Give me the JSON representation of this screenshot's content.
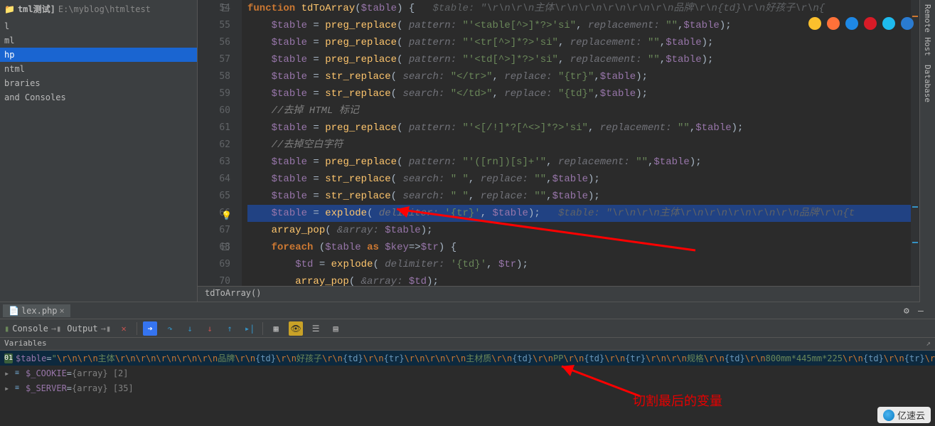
{
  "sidebar": {
    "project_label": "tml测试]",
    "project_path": "E:\\myblog\\htmltest",
    "items": [
      {
        "label": "l"
      },
      {
        "label": "ml"
      },
      {
        "label": "hp"
      },
      {
        "label": "ntml"
      },
      {
        "label": "braries"
      },
      {
        "label": "and Consoles"
      }
    ],
    "selected_index": 2
  },
  "right_tabs": [
    "Remote Host",
    "Database"
  ],
  "browsers": [
    {
      "name": "chrome",
      "color": "#fbc02d"
    },
    {
      "name": "firefox",
      "color": "#ff7139"
    },
    {
      "name": "safari",
      "color": "#1e88e5"
    },
    {
      "name": "opera",
      "color": "#d81b27"
    },
    {
      "name": "ie",
      "color": "#1ebbee"
    },
    {
      "name": "edge",
      "color": "#2a7bd1"
    }
  ],
  "editor": {
    "breadcrumb": "tdToArray()",
    "highlight_line": 66,
    "breakpoint_line": 55,
    "bulb_line": 66,
    "lines": [
      {
        "n": 54,
        "raw": "function tdToArray($table) {   $table: \"\\r\\n\\r\\n主体\\r\\n\\r\\n\\r\\n\\r\\n\\r\\n品牌\\r\\n{td}\\r\\n好孩子\\r\\n{",
        "segments": [
          {
            "t": "function ",
            "c": "kw"
          },
          {
            "t": "tdToArray",
            "c": "fn"
          },
          {
            "t": "(",
            "c": "op"
          },
          {
            "t": "$table",
            "c": "var"
          },
          {
            "t": ") {",
            "c": "op"
          },
          {
            "t": "   $table: \"\\r\\n\\r\\n主体\\r\\n\\r\\n\\r\\n\\r\\n\\r\\n品牌\\r\\n{td}\\r\\n好孩子\\r\\n{",
            "c": "hint"
          }
        ]
      },
      {
        "n": 55,
        "segments": [
          {
            "t": "    ",
            "c": "op"
          },
          {
            "t": "$table",
            "c": "var"
          },
          {
            "t": " = ",
            "c": "op"
          },
          {
            "t": "preg_replace",
            "c": "fn"
          },
          {
            "t": "( ",
            "c": "op"
          },
          {
            "t": "pattern:",
            "c": "pname"
          },
          {
            "t": " ",
            "c": "op"
          },
          {
            "t": "\"'<table[^>]*?>'si\"",
            "c": "str"
          },
          {
            "t": ", ",
            "c": "op"
          },
          {
            "t": "replacement:",
            "c": "pname"
          },
          {
            "t": " ",
            "c": "op"
          },
          {
            "t": "\"\"",
            "c": "str"
          },
          {
            "t": ",",
            "c": "op"
          },
          {
            "t": "$table",
            "c": "var"
          },
          {
            "t": ");",
            "c": "op"
          }
        ]
      },
      {
        "n": 56,
        "segments": [
          {
            "t": "    ",
            "c": "op"
          },
          {
            "t": "$table",
            "c": "var"
          },
          {
            "t": " = ",
            "c": "op"
          },
          {
            "t": "preg_replace",
            "c": "fn"
          },
          {
            "t": "( ",
            "c": "op"
          },
          {
            "t": "pattern:",
            "c": "pname"
          },
          {
            "t": " ",
            "c": "op"
          },
          {
            "t": "\"'<tr[^>]*?>'si\"",
            "c": "str"
          },
          {
            "t": ", ",
            "c": "op"
          },
          {
            "t": "replacement:",
            "c": "pname"
          },
          {
            "t": " ",
            "c": "op"
          },
          {
            "t": "\"\"",
            "c": "str"
          },
          {
            "t": ",",
            "c": "op"
          },
          {
            "t": "$table",
            "c": "var"
          },
          {
            "t": ");",
            "c": "op"
          }
        ]
      },
      {
        "n": 57,
        "segments": [
          {
            "t": "    ",
            "c": "op"
          },
          {
            "t": "$table",
            "c": "var"
          },
          {
            "t": " = ",
            "c": "op"
          },
          {
            "t": "preg_replace",
            "c": "fn"
          },
          {
            "t": "( ",
            "c": "op"
          },
          {
            "t": "pattern:",
            "c": "pname"
          },
          {
            "t": " ",
            "c": "op"
          },
          {
            "t": "\"'<td[^>]*?>'si\"",
            "c": "str"
          },
          {
            "t": ", ",
            "c": "op"
          },
          {
            "t": "replacement:",
            "c": "pname"
          },
          {
            "t": " ",
            "c": "op"
          },
          {
            "t": "\"\"",
            "c": "str"
          },
          {
            "t": ",",
            "c": "op"
          },
          {
            "t": "$table",
            "c": "var"
          },
          {
            "t": ");",
            "c": "op"
          }
        ]
      },
      {
        "n": 58,
        "segments": [
          {
            "t": "    ",
            "c": "op"
          },
          {
            "t": "$table",
            "c": "var"
          },
          {
            "t": " = ",
            "c": "op"
          },
          {
            "t": "str_replace",
            "c": "fn"
          },
          {
            "t": "( ",
            "c": "op"
          },
          {
            "t": "search:",
            "c": "pname"
          },
          {
            "t": " ",
            "c": "op"
          },
          {
            "t": "\"</tr>\"",
            "c": "str"
          },
          {
            "t": ", ",
            "c": "op"
          },
          {
            "t": "replace:",
            "c": "pname"
          },
          {
            "t": " ",
            "c": "op"
          },
          {
            "t": "\"{tr}\"",
            "c": "str"
          },
          {
            "t": ",",
            "c": "op"
          },
          {
            "t": "$table",
            "c": "var"
          },
          {
            "t": ");",
            "c": "op"
          }
        ]
      },
      {
        "n": 59,
        "segments": [
          {
            "t": "    ",
            "c": "op"
          },
          {
            "t": "$table",
            "c": "var"
          },
          {
            "t": " = ",
            "c": "op"
          },
          {
            "t": "str_replace",
            "c": "fn"
          },
          {
            "t": "( ",
            "c": "op"
          },
          {
            "t": "search:",
            "c": "pname"
          },
          {
            "t": " ",
            "c": "op"
          },
          {
            "t": "\"</td>\"",
            "c": "str"
          },
          {
            "t": ", ",
            "c": "op"
          },
          {
            "t": "replace:",
            "c": "pname"
          },
          {
            "t": " ",
            "c": "op"
          },
          {
            "t": "\"{td}\"",
            "c": "str"
          },
          {
            "t": ",",
            "c": "op"
          },
          {
            "t": "$table",
            "c": "var"
          },
          {
            "t": ");",
            "c": "op"
          }
        ]
      },
      {
        "n": 60,
        "segments": [
          {
            "t": "    //去掉 HTML 标记",
            "c": "comment"
          }
        ]
      },
      {
        "n": 61,
        "segments": [
          {
            "t": "    ",
            "c": "op"
          },
          {
            "t": "$table",
            "c": "var"
          },
          {
            "t": " = ",
            "c": "op"
          },
          {
            "t": "preg_replace",
            "c": "fn"
          },
          {
            "t": "( ",
            "c": "op"
          },
          {
            "t": "pattern:",
            "c": "pname"
          },
          {
            "t": " ",
            "c": "op"
          },
          {
            "t": "\"'<[/!]*?[^<>]*?>'si\"",
            "c": "str"
          },
          {
            "t": ", ",
            "c": "op"
          },
          {
            "t": "replacement:",
            "c": "pname"
          },
          {
            "t": " ",
            "c": "op"
          },
          {
            "t": "\"\"",
            "c": "str"
          },
          {
            "t": ",",
            "c": "op"
          },
          {
            "t": "$table",
            "c": "var"
          },
          {
            "t": ");",
            "c": "op"
          }
        ]
      },
      {
        "n": 62,
        "segments": [
          {
            "t": "    //去掉空白字符",
            "c": "comment"
          }
        ]
      },
      {
        "n": 63,
        "segments": [
          {
            "t": "    ",
            "c": "op"
          },
          {
            "t": "$table",
            "c": "var"
          },
          {
            "t": " = ",
            "c": "op"
          },
          {
            "t": "preg_replace",
            "c": "fn"
          },
          {
            "t": "( ",
            "c": "op"
          },
          {
            "t": "pattern:",
            "c": "pname"
          },
          {
            "t": " ",
            "c": "op"
          },
          {
            "t": "\"'([rn])[s]+'\"",
            "c": "str"
          },
          {
            "t": ", ",
            "c": "op"
          },
          {
            "t": "replacement:",
            "c": "pname"
          },
          {
            "t": " ",
            "c": "op"
          },
          {
            "t": "\"\"",
            "c": "str"
          },
          {
            "t": ",",
            "c": "op"
          },
          {
            "t": "$table",
            "c": "var"
          },
          {
            "t": ");",
            "c": "op"
          }
        ]
      },
      {
        "n": 64,
        "segments": [
          {
            "t": "    ",
            "c": "op"
          },
          {
            "t": "$table",
            "c": "var"
          },
          {
            "t": " = ",
            "c": "op"
          },
          {
            "t": "str_replace",
            "c": "fn"
          },
          {
            "t": "( ",
            "c": "op"
          },
          {
            "t": "search:",
            "c": "pname"
          },
          {
            "t": " ",
            "c": "op"
          },
          {
            "t": "\" \"",
            "c": "str"
          },
          {
            "t": ", ",
            "c": "op"
          },
          {
            "t": "replace:",
            "c": "pname"
          },
          {
            "t": " ",
            "c": "op"
          },
          {
            "t": "\"\"",
            "c": "str"
          },
          {
            "t": ",",
            "c": "op"
          },
          {
            "t": "$table",
            "c": "var"
          },
          {
            "t": ");",
            "c": "op"
          }
        ]
      },
      {
        "n": 65,
        "segments": [
          {
            "t": "    ",
            "c": "op"
          },
          {
            "t": "$table",
            "c": "var"
          },
          {
            "t": " = ",
            "c": "op"
          },
          {
            "t": "str_replace",
            "c": "fn"
          },
          {
            "t": "( ",
            "c": "op"
          },
          {
            "t": "search:",
            "c": "pname"
          },
          {
            "t": " ",
            "c": "op"
          },
          {
            "t": "\" \"",
            "c": "str"
          },
          {
            "t": ", ",
            "c": "op"
          },
          {
            "t": "replace:",
            "c": "pname"
          },
          {
            "t": " ",
            "c": "op"
          },
          {
            "t": "\"\"",
            "c": "str"
          },
          {
            "t": ",",
            "c": "op"
          },
          {
            "t": "$table",
            "c": "var"
          },
          {
            "t": ");",
            "c": "op"
          }
        ]
      },
      {
        "n": 66,
        "hl": true,
        "segments": [
          {
            "t": "    ",
            "c": "op"
          },
          {
            "t": "$table",
            "c": "var"
          },
          {
            "t": " = ",
            "c": "op"
          },
          {
            "t": "explode",
            "c": "fn"
          },
          {
            "t": "( ",
            "c": "op"
          },
          {
            "t": "delimiter:",
            "c": "pname"
          },
          {
            "t": " ",
            "c": "op"
          },
          {
            "t": "'{tr}'",
            "c": "str"
          },
          {
            "t": ", ",
            "c": "op"
          },
          {
            "t": "$table",
            "c": "var"
          },
          {
            "t": ");",
            "c": "op"
          },
          {
            "t": "   $table: \"\\r\\n\\r\\n主体\\r\\n\\r\\n\\r\\n\\r\\n\\r\\n品牌\\r\\n{t",
            "c": "hint"
          }
        ]
      },
      {
        "n": 67,
        "segments": [
          {
            "t": "    ",
            "c": "op"
          },
          {
            "t": "array_pop",
            "c": "fn"
          },
          {
            "t": "( ",
            "c": "op"
          },
          {
            "t": "&array:",
            "c": "pname"
          },
          {
            "t": " ",
            "c": "op"
          },
          {
            "t": "$table",
            "c": "var"
          },
          {
            "t": ");",
            "c": "op"
          }
        ]
      },
      {
        "n": 68,
        "segments": [
          {
            "t": "    ",
            "c": "op"
          },
          {
            "t": "foreach ",
            "c": "kw"
          },
          {
            "t": "(",
            "c": "op"
          },
          {
            "t": "$table",
            "c": "var"
          },
          {
            "t": " ",
            "c": "op"
          },
          {
            "t": "as",
            "c": "kw"
          },
          {
            "t": " ",
            "c": "op"
          },
          {
            "t": "$key",
            "c": "var"
          },
          {
            "t": "=>",
            "c": "op"
          },
          {
            "t": "$tr",
            "c": "var"
          },
          {
            "t": ") {",
            "c": "op"
          }
        ]
      },
      {
        "n": 69,
        "segments": [
          {
            "t": "        ",
            "c": "op"
          },
          {
            "t": "$td",
            "c": "var"
          },
          {
            "t": " = ",
            "c": "op"
          },
          {
            "t": "explode",
            "c": "fn"
          },
          {
            "t": "( ",
            "c": "op"
          },
          {
            "t": "delimiter:",
            "c": "pname"
          },
          {
            "t": " ",
            "c": "op"
          },
          {
            "t": "'{td}'",
            "c": "str"
          },
          {
            "t": ", ",
            "c": "op"
          },
          {
            "t": "$tr",
            "c": "var"
          },
          {
            "t": ");",
            "c": "op"
          }
        ]
      },
      {
        "n": 70,
        "segments": [
          {
            "t": "        ",
            "c": "op"
          },
          {
            "t": "array_pop",
            "c": "fn"
          },
          {
            "t": "( ",
            "c": "op"
          },
          {
            "t": "&array:",
            "c": "pname"
          },
          {
            "t": " ",
            "c": "op"
          },
          {
            "t": "$td",
            "c": "var"
          },
          {
            "t": ");",
            "c": "op"
          }
        ]
      }
    ]
  },
  "debug": {
    "tab_file": "lex.php",
    "console_label": "Console",
    "output_label": "Output",
    "variables_label": "Variables",
    "vars": [
      {
        "name": "$table",
        "type": "string",
        "pieces": [
          {
            "t": "\"",
            "c": "vstr"
          },
          {
            "t": "\\r\\n\\r\\n",
            "c": "vesc"
          },
          {
            "t": "主体",
            "c": "vstr"
          },
          {
            "t": "\\r\\n\\r\\n\\r\\n\\r\\n\\r\\n",
            "c": "vesc"
          },
          {
            "t": "品牌",
            "c": "vstr"
          },
          {
            "t": "\\r\\n",
            "c": "vesc"
          },
          {
            "t": "{td}",
            "c": "vtag"
          },
          {
            "t": "\\r\\n",
            "c": "vesc"
          },
          {
            "t": "好孩子",
            "c": "vstr"
          },
          {
            "t": "\\r\\n",
            "c": "vesc"
          },
          {
            "t": "{td}",
            "c": "vtag"
          },
          {
            "t": "\\r\\n",
            "c": "vesc"
          },
          {
            "t": "{tr}",
            "c": "vtag"
          },
          {
            "t": "\\r\\n\\r\\n\\r\\n",
            "c": "vesc"
          },
          {
            "t": "主材质",
            "c": "vstr"
          },
          {
            "t": "\\r\\n",
            "c": "vesc"
          },
          {
            "t": "{td}",
            "c": "vtag"
          },
          {
            "t": "\\r\\n",
            "c": "vesc"
          },
          {
            "t": "PP",
            "c": "vstr"
          },
          {
            "t": "\\r\\n",
            "c": "vesc"
          },
          {
            "t": "{td}",
            "c": "vtag"
          },
          {
            "t": "\\r\\n",
            "c": "vesc"
          },
          {
            "t": "{tr}",
            "c": "vtag"
          },
          {
            "t": "\\r\\n\\r\\n",
            "c": "vesc"
          },
          {
            "t": "规格",
            "c": "vstr"
          },
          {
            "t": "\\r\\n",
            "c": "vesc"
          },
          {
            "t": "{td}",
            "c": "vtag"
          },
          {
            "t": "\\r\\n",
            "c": "vesc"
          },
          {
            "t": "800mm*445mm*225",
            "c": "vstr"
          },
          {
            "t": "\\r\\n",
            "c": "vesc"
          },
          {
            "t": "{td}",
            "c": "vtag"
          },
          {
            "t": "\\r\\n",
            "c": "vesc"
          },
          {
            "t": "{tr}",
            "c": "vtag"
          },
          {
            "t": "\\r\\n",
            "c": "vesc"
          },
          {
            "t": "\"",
            "c": "vstr"
          }
        ]
      },
      {
        "name": "$_COOKIE",
        "meta": "{array} [2]"
      },
      {
        "name": "$_SERVER",
        "meta": "{array} [35]"
      }
    ]
  },
  "annotation": {
    "text": "切割最后的变量"
  },
  "watermark": "亿速云"
}
